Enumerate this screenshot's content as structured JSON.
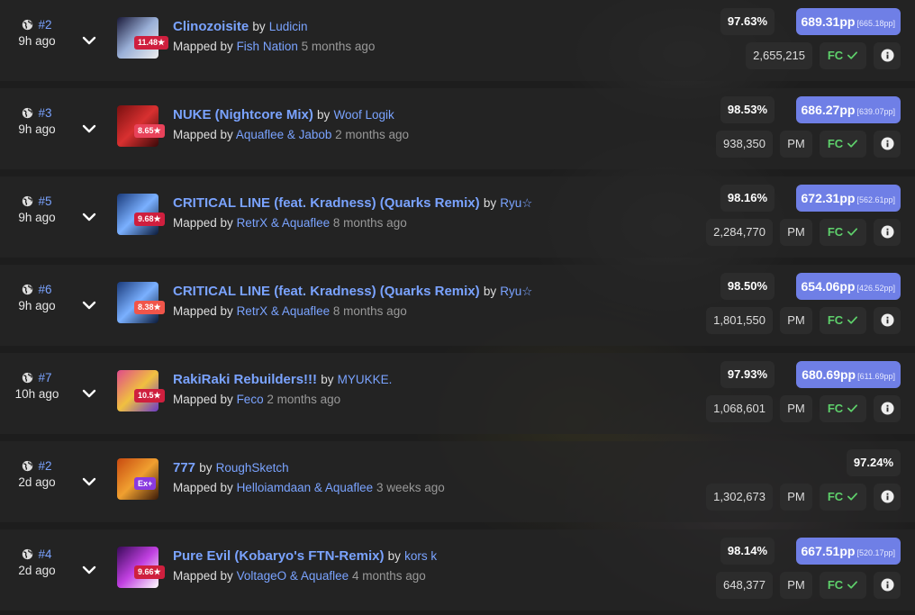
{
  "scores": [
    {
      "rank": "#2",
      "ago": "9h ago",
      "stars": "11.48★",
      "title": "Clinozoisite",
      "artist": "Ludicin",
      "mappers": "Fish Nation",
      "mapped_ago": "5 months ago",
      "accuracy": "97.63%",
      "pp": "689.31pp",
      "raw_pp": "[665.18pp]",
      "score": "2,655,215",
      "mods": "",
      "fc": "FC",
      "star_color": "#cf1f3e",
      "cover_colors": [
        "#1a1a3a",
        "#9ab0d8",
        "#eeeeee"
      ]
    },
    {
      "rank": "#3",
      "ago": "9h ago",
      "stars": "8.65★",
      "title": "NUKE (Nightcore Mix)",
      "artist": "Woof Logik",
      "mappers": "Aquaflee & Jabob",
      "mapped_ago": "2 months ago",
      "accuracy": "98.53%",
      "pp": "686.27pp",
      "raw_pp": "[639.07pp]",
      "score": "938,350",
      "mods": "PM",
      "fc": "FC",
      "star_color": "#e8425a",
      "cover_colors": [
        "#7a1010",
        "#d83030",
        "#3a0808"
      ]
    },
    {
      "rank": "#5",
      "ago": "9h ago",
      "stars": "9.68★",
      "title": "CRITICAL LINE (feat. Kradness) (Quarks Remix)",
      "artist": "Ryu☆",
      "mappers": "RetrX & Aquaflee",
      "mapped_ago": "8 months ago",
      "accuracy": "98.16%",
      "pp": "672.31pp",
      "raw_pp": "[562.61pp]",
      "score": "2,284,770",
      "mods": "PM",
      "fc": "FC",
      "star_color": "#cf1f3e",
      "cover_colors": [
        "#1a3a7a",
        "#7ab0ff",
        "#0a1a3a"
      ]
    },
    {
      "rank": "#6",
      "ago": "9h ago",
      "stars": "8.38★",
      "title": "CRITICAL LINE (feat. Kradness) (Quarks Remix)",
      "artist": "Ryu☆",
      "mappers": "RetrX & Aquaflee",
      "mapped_ago": "8 months ago",
      "accuracy": "98.50%",
      "pp": "654.06pp",
      "raw_pp": "[426.52pp]",
      "score": "1,801,550",
      "mods": "PM",
      "fc": "FC",
      "star_color": "#f0554a",
      "cover_colors": [
        "#1a3a7a",
        "#7ab0ff",
        "#0a1a3a"
      ]
    },
    {
      "rank": "#7",
      "ago": "10h ago",
      "stars": "10.5★",
      "title": "RakiRaki Rebuilders!!!",
      "artist": "MYUKKE.",
      "mappers": "Feco",
      "mapped_ago": "2 months ago",
      "accuracy": "97.93%",
      "pp": "680.69pp",
      "raw_pp": "[611.69pp]",
      "score": "1,068,601",
      "mods": "PM",
      "fc": "FC",
      "star_color": "#cf1f3e",
      "cover_colors": [
        "#e04a8a",
        "#f0c040",
        "#6a3ac8"
      ]
    },
    {
      "rank": "#2",
      "ago": "2d ago",
      "stars": "Ex+",
      "title": "777",
      "artist": "RoughSketch",
      "mappers": "Helloiamdaan & Aquaflee",
      "mapped_ago": "3 weeks ago",
      "accuracy": "97.24%",
      "pp": "",
      "raw_pp": "",
      "score": "1,302,673",
      "mods": "PM",
      "fc": "FC",
      "star_color": "#8a3ae0",
      "cover_colors": [
        "#c84a10",
        "#f0a030",
        "#3a1a08"
      ]
    },
    {
      "rank": "#4",
      "ago": "2d ago",
      "stars": "9.66★",
      "title": "Pure Evil (Kobaryo's FTN-Remix)",
      "artist": "kors k",
      "mappers": "VoltageO & Aquaflee",
      "mapped_ago": "4 months ago",
      "accuracy": "98.14%",
      "pp": "667.51pp",
      "raw_pp": "[520.17pp]",
      "score": "648,377",
      "mods": "PM",
      "fc": "FC",
      "star_color": "#cf1f3e",
      "cover_colors": [
        "#3a0a5a",
        "#c040e0",
        "#ffffff"
      ]
    }
  ],
  "labels": {
    "by": "by",
    "mapped_by": "Mapped by"
  }
}
